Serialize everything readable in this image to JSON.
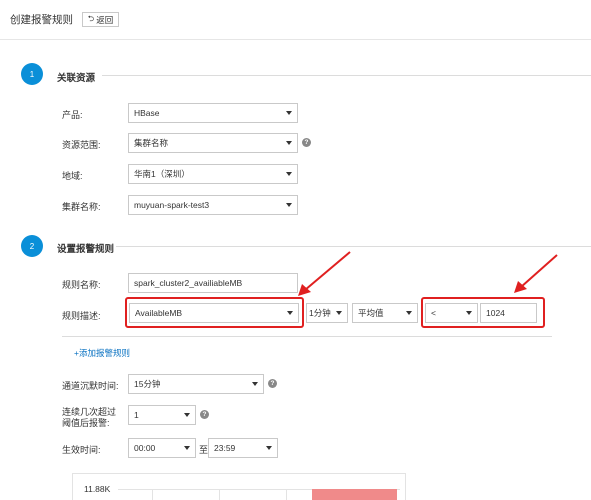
{
  "header": {
    "title": "创建报警规则",
    "back_label": "返回"
  },
  "step1": {
    "number": "1",
    "title": "关联资源",
    "fields": [
      {
        "label": "产品:",
        "value": "HBase"
      },
      {
        "label": "资源范围:",
        "value": "集群名称"
      },
      {
        "label": "地域:",
        "value": "华南1（深圳）"
      },
      {
        "label": "集群名称:",
        "value": "muyuan-spark-test3"
      }
    ]
  },
  "step2": {
    "number": "2",
    "title": "设置报警规则",
    "rule_name_label": "规则名称:",
    "rule_name_value": "spark_cluster2_availiableMB",
    "rule_desc_label": "规则描述:",
    "metric": "AvailableMB",
    "period": "1分钟",
    "stat": "平均值",
    "operator": "<",
    "threshold": "1024",
    "add_rule_label": "+添加报警规则",
    "silence_label": "通道沉默时间:",
    "silence_value": "15分钟",
    "times_label_line1": "连续几次超过",
    "times_label_line2": "阈值后报警:",
    "times_value": "1",
    "effective_label": "生效时间:",
    "effective_start": "00:00",
    "effective_sep": "至",
    "effective_end": "23:59"
  },
  "chart": {
    "y_top_label": "11.88K"
  },
  "colors": {
    "accent": "#0a8fd8",
    "annotation": "#e02020",
    "link": "#0a72c2",
    "chart_fill": "#f08a8a"
  }
}
